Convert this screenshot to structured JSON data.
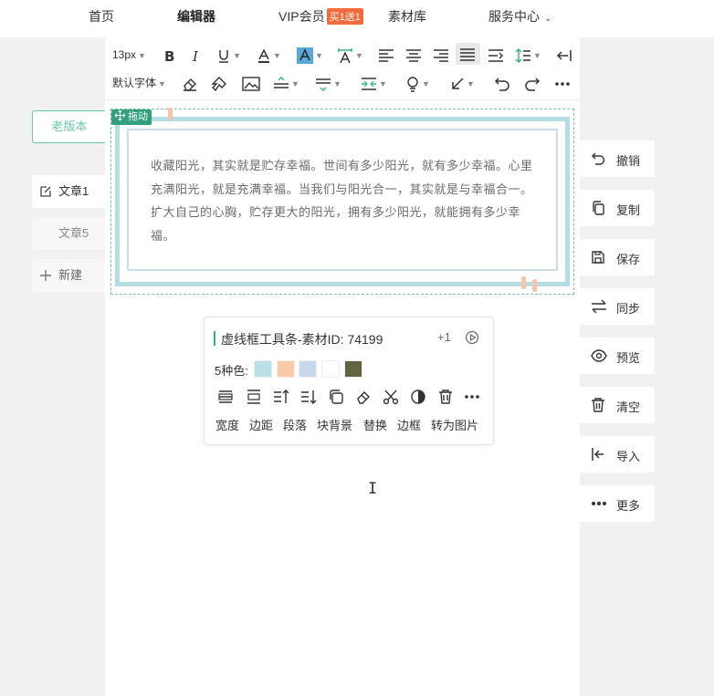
{
  "nav": {
    "home": "首页",
    "editor": "编辑器",
    "vip": "VIP会员",
    "vip_badge": "买1送1",
    "materials": "素材库",
    "service": "服务中心"
  },
  "sidebar": {
    "old_version": "老版本",
    "articles": [
      {
        "label": "文章1",
        "active": true
      },
      {
        "label": "文章5",
        "active": false
      }
    ],
    "new_label": "新建"
  },
  "toolbar": {
    "font_size": "13px",
    "font_family": "默认字体"
  },
  "frame": {
    "drag_label": "拖动",
    "text": "收藏阳光，其实就是贮存幸福。世间有多少阳光，就有多少幸福。心里充满阳光，就是充满幸福。当我们与阳光合一，其实就是与幸福合一。扩大自己的心胸，贮存更大的阳光，拥有多少阳光，就能拥有多少幸福。"
  },
  "popup": {
    "title": "虚线框工具条-素材ID: 74199",
    "plus": "+1",
    "colors_label": "5种色:",
    "swatches": [
      "#b8dfe5",
      "#f9c9a9",
      "#c6d8ea",
      "#ffffff",
      "#626340"
    ],
    "actions": [
      "宽度",
      "边距",
      "段落",
      "块背景",
      "替换",
      "边框",
      "转为图片"
    ]
  },
  "right_panel": {
    "items": [
      "撤销",
      "复制",
      "保存",
      "同步",
      "预览",
      "清空",
      "导入",
      "更多"
    ]
  },
  "colors": {
    "accent": "#34b385",
    "frame_border": "#b4dee3",
    "frame_dashed": "#6fc7af"
  }
}
